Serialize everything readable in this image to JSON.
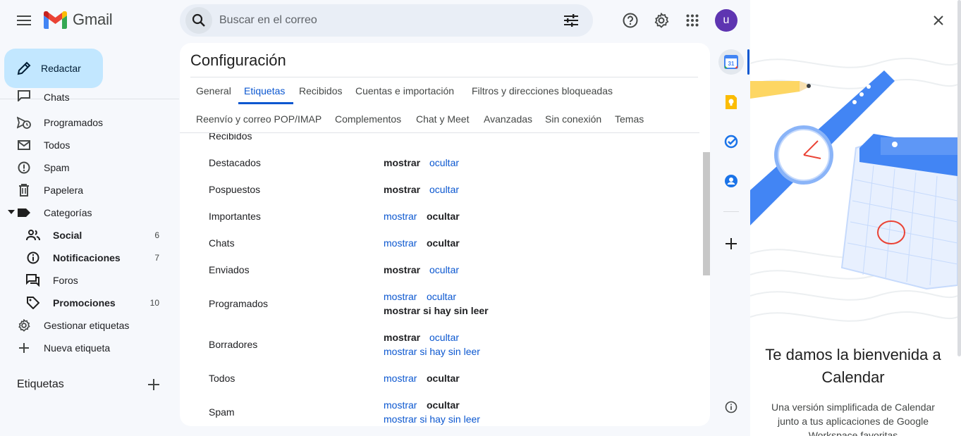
{
  "header": {
    "app_name": "Gmail",
    "search_placeholder": "Buscar en el correo",
    "avatar_letter": "u"
  },
  "sidebar": {
    "compose_label": "Redactar",
    "items": [
      {
        "label": "Chats",
        "icon": "chat-icon"
      },
      {
        "label": "Programados",
        "icon": "scheduled-icon"
      },
      {
        "label": "Todos",
        "icon": "mail-icon"
      },
      {
        "label": "Spam",
        "icon": "spam-icon"
      },
      {
        "label": "Papelera",
        "icon": "trash-icon"
      },
      {
        "label": "Categorías",
        "icon": "label-icon"
      }
    ],
    "categories": [
      {
        "label": "Social",
        "count": "6",
        "icon": "people-icon"
      },
      {
        "label": "Notificaciones",
        "count": "7",
        "icon": "info-icon"
      },
      {
        "label": "Foros",
        "count": "",
        "icon": "forum-icon"
      },
      {
        "label": "Promociones",
        "count": "10",
        "icon": "tag-icon"
      }
    ],
    "manage_labels": "Gestionar etiquetas",
    "new_label": "Nueva etiqueta",
    "labels_header": "Etiquetas"
  },
  "settings": {
    "title": "Configuración",
    "tabs_row1": [
      "General",
      "Etiquetas",
      "Recibidos",
      "Cuentas e importación",
      "Filtros y direcciones bloqueadas"
    ],
    "tabs_row2": [
      "Reenvío y correo POP/IMAP",
      "Complementos",
      "Chat y Meet",
      "Avanzadas",
      "Sin conexión",
      "Temas"
    ],
    "active_tab": "Etiquetas",
    "show": "mostrar",
    "hide": "ocultar",
    "show_if_unread": "mostrar si hay sin leer",
    "partial_row": "Recibidos",
    "rows": [
      {
        "label": "Destacados",
        "state": "show"
      },
      {
        "label": "Pospuestos",
        "state": "show"
      },
      {
        "label": "Importantes",
        "state": "hide"
      },
      {
        "label": "Chats",
        "state": "hide"
      },
      {
        "label": "Enviados",
        "state": "show"
      },
      {
        "label": "Programados",
        "state": "unread"
      },
      {
        "label": "Borradores",
        "state": "show"
      },
      {
        "label": "Todos",
        "state": "hide"
      },
      {
        "label": "Spam",
        "state": "hide"
      }
    ]
  },
  "side_panel": {
    "title": "Te damos la bienvenida a Calendar",
    "body": "Una versión simplificada de Calendar junto a tus aplicaciones de Google Workspace favoritas"
  },
  "colors": {
    "accent": "#0b57d0",
    "compose_bg": "#c2e7ff",
    "avatar": "#5e35b1"
  }
}
